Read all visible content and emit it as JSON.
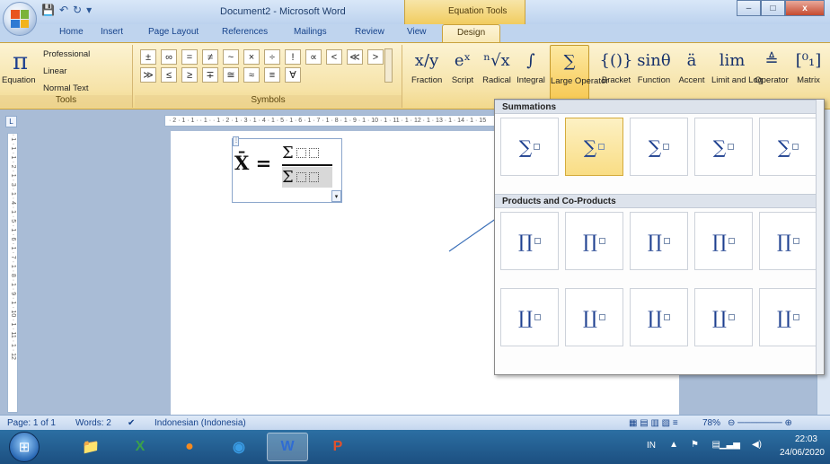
{
  "window": {
    "title": "Document2 - Microsoft Word",
    "context_tab": "Equation Tools",
    "buttons": {
      "minimize": "–",
      "maximize": "□",
      "close": "x"
    }
  },
  "tabs": [
    "Home",
    "Insert",
    "Page Layout",
    "References",
    "Mailings",
    "Review",
    "View",
    "Design"
  ],
  "active_tab": "Design",
  "ribbon": {
    "tools": {
      "equation_label": "Equation",
      "options": [
        "Professional",
        "Linear",
        "Normal Text"
      ],
      "group_label": "Tools"
    },
    "symbols": {
      "group_label": "Symbols",
      "items": [
        "±",
        "∞",
        "=",
        "≠",
        "~",
        "×",
        "÷",
        "!",
        "∝",
        "<",
        "≪",
        ">",
        "≫",
        "≤",
        "≥",
        "∓",
        "≅",
        "≈",
        "≡",
        "∀"
      ]
    },
    "structures": [
      {
        "icon": "x/y",
        "label": "Fraction"
      },
      {
        "icon": "eˣ",
        "label": "Script"
      },
      {
        "icon": "ⁿ√x",
        "label": "Radical"
      },
      {
        "icon": "∫",
        "label": "Integral"
      },
      {
        "icon": "∑",
        "label": "Large Operator"
      },
      {
        "icon": "{()}",
        "label": "Bracket"
      },
      {
        "icon": "sinθ",
        "label": "Function"
      },
      {
        "icon": "ä",
        "label": "Accent"
      },
      {
        "icon": "lim",
        "label": "Limit and Log"
      },
      {
        "icon": "≜",
        "label": "Operator"
      },
      {
        "icon": "[⁰₁]",
        "label": "Matrix"
      }
    ],
    "selected_structure": "Large Operator"
  },
  "document": {
    "equation_lhs": "X̄ =",
    "numerator_symbol": "Σ",
    "denominator_symbol": "Σ"
  },
  "gallery": {
    "sections": [
      {
        "title": "Summations",
        "symbol": "∑"
      },
      {
        "title": "Products and Co-Products",
        "symbol": "∏"
      },
      {
        "title": "",
        "symbol": "∐"
      }
    ]
  },
  "status": {
    "page": "Page: 1 of 1",
    "words": "Words: 2",
    "language": "Indonesian (Indonesia)",
    "zoom": "78%"
  },
  "taskbar": {
    "lang": "IN",
    "time": "22:03",
    "date": "24/06/2020"
  },
  "ruler": {
    "h": "· 2 · 1 · 1 · · 1 · · 1 · 2 · 1 · 3 · 1 · 4 · 1 · 5 · 1 · 6 · 1 · 7 · 1 · 8 · 1 · 9 · 1 · 10 · 1 · 11 · 1 · 12 · 1 · 13 · 1 · 14 · 1 · 15",
    "v": "· 1 · 1 · 1 · 2 · 1 · 3 · 1 · 4 · 1 · 5 · 1 · 6 · 1 · 7 · 1 · 8 · 1 · 9 · 1 · 10 · 1 · 11 · 1 · 12"
  },
  "colors": {
    "accent": "#f7c851",
    "ribbon": "#f6e3a8",
    "taskbar": "#1c4f80"
  }
}
